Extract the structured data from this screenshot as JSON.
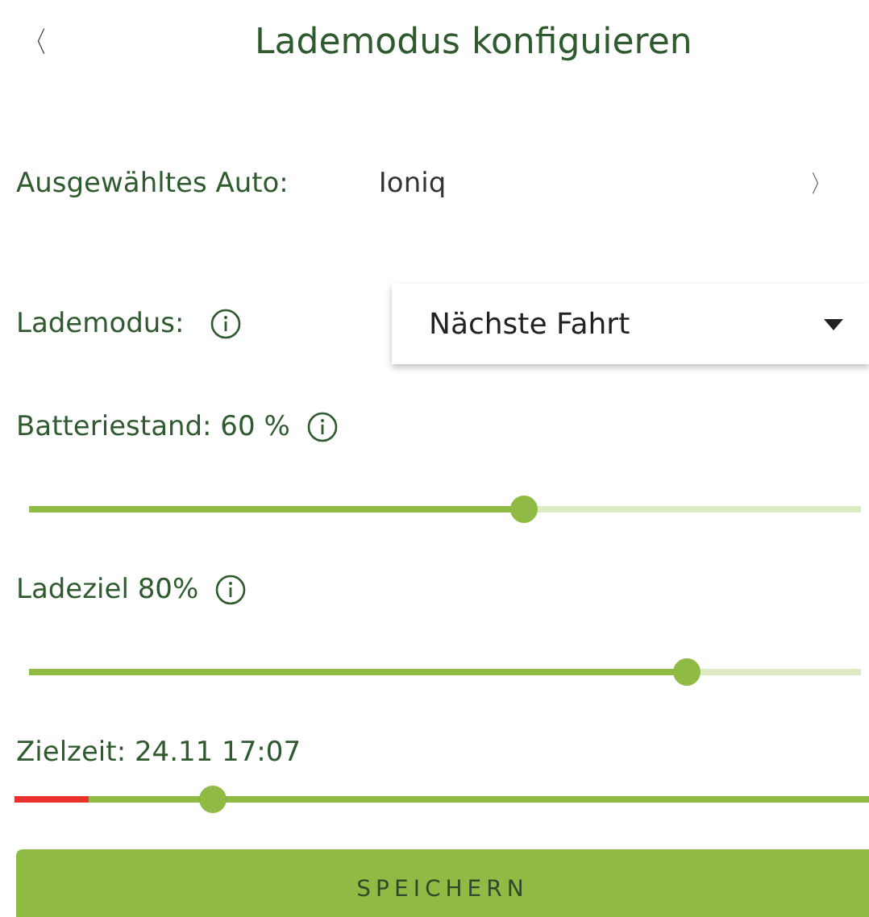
{
  "header": {
    "back": "〈",
    "title": "Lademodus konfiguieren"
  },
  "car": {
    "label": "Ausgewähltes Auto:",
    "value": "Ioniq",
    "chevron": "〉"
  },
  "mode": {
    "label": "Lademodus:",
    "value": "Nächste Fahrt"
  },
  "sliders": [
    {
      "label": "Batteriestand: 60 %",
      "info": true,
      "level": 0.595,
      "kind": "split"
    },
    {
      "label": "Ladeziel 80%",
      "info": true,
      "level": 0.79,
      "kind": "split"
    },
    {
      "label": "Zielzeit: 24.11 17:07",
      "info": false,
      "level": 0.232,
      "kind": "time"
    }
  ],
  "save_button": "SPEICHERN"
}
